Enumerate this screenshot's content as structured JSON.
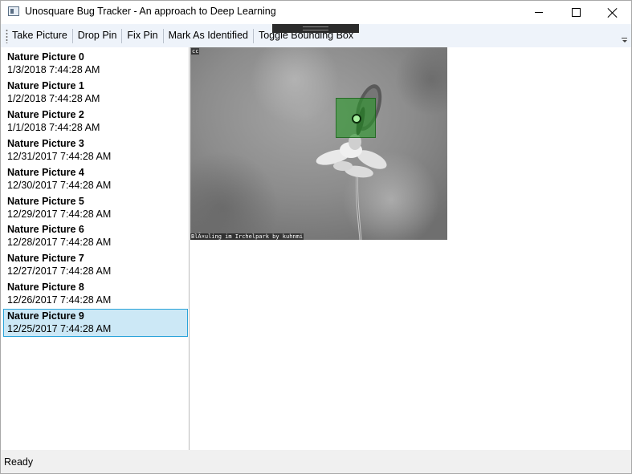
{
  "window": {
    "title": "Unosquare Bug Tracker - An approach to Deep Learning"
  },
  "toolbar": {
    "buttons": [
      {
        "label": "Take Picture"
      },
      {
        "label": "Drop Pin"
      },
      {
        "label": "Fix Pin"
      },
      {
        "label": "Mark As Identified"
      },
      {
        "label": "Toggle Bounding Box"
      }
    ]
  },
  "list": {
    "selected_index": 9,
    "items": [
      {
        "name": "Nature Picture 0",
        "date": "1/3/2018 7:44:28 AM"
      },
      {
        "name": "Nature Picture 1",
        "date": "1/2/2018 7:44:28 AM"
      },
      {
        "name": "Nature Picture 2",
        "date": "1/1/2018 7:44:28 AM"
      },
      {
        "name": "Nature Picture 3",
        "date": "12/31/2017 7:44:28 AM"
      },
      {
        "name": "Nature Picture 4",
        "date": "12/30/2017 7:44:28 AM"
      },
      {
        "name": "Nature Picture 5",
        "date": "12/29/2017 7:44:28 AM"
      },
      {
        "name": "Nature Picture 6",
        "date": "12/28/2017 7:44:28 AM"
      },
      {
        "name": "Nature Picture 7",
        "date": "12/27/2017 7:44:28 AM"
      },
      {
        "name": "Nature Picture 8",
        "date": "12/26/2017 7:44:28 AM"
      },
      {
        "name": "Nature Picture 9",
        "date": "12/25/2017 7:44:28 AM"
      }
    ]
  },
  "image": {
    "license_label": "cc",
    "caption": "BlÃ¤uling im Irchelpark by kuhnmi"
  },
  "status": {
    "text": "Ready"
  },
  "colors": {
    "selection_background": "#cce8f6",
    "selection_border": "#29a3d9",
    "bounding_box": "#2a962a",
    "pin_fill": "#a8f0a0",
    "toolbar_background": "#eef3fa",
    "statusbar_background": "#f0f0f0"
  },
  "icons": {
    "app": "app-window-icon",
    "minimize": "minimize-icon",
    "maximize": "maximize-icon",
    "close": "close-icon",
    "toolbar_grip": "toolbar-grip-icon",
    "toolbar_overflow": "toolbar-overflow-icon"
  }
}
